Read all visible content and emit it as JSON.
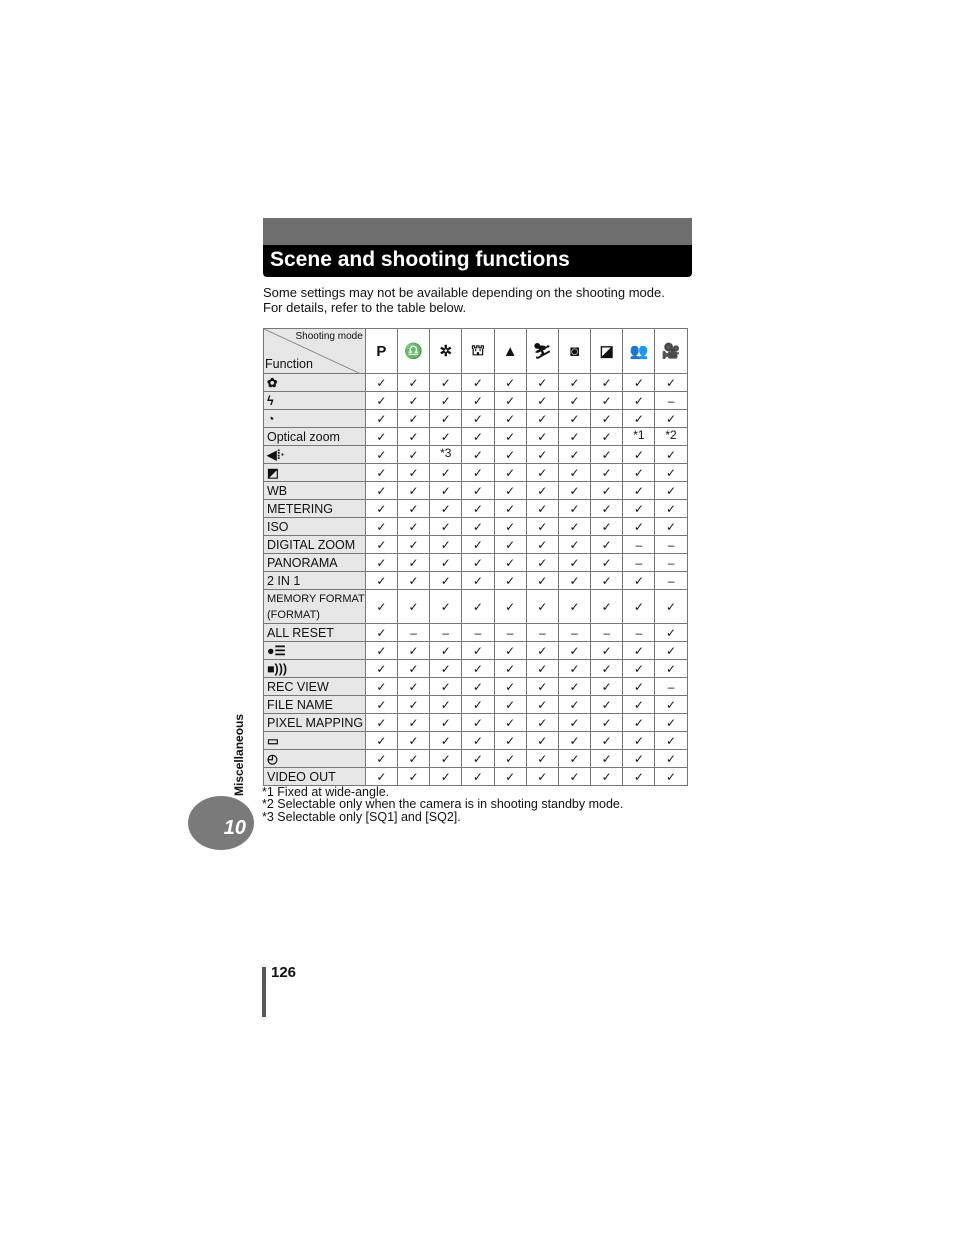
{
  "title": "Scene and shooting functions",
  "intro": [
    "Some settings may not be available depending on the shooting mode.",
    "For details, refer to the table below."
  ],
  "table": {
    "corner_top": "Shooting mode",
    "corner_bottom": "Function",
    "modes": [
      {
        "icon": "program-mode-icon",
        "glyph": "P"
      },
      {
        "icon": "portrait-icon",
        "glyph": "♎"
      },
      {
        "icon": "night-scene-icon",
        "glyph": "✲"
      },
      {
        "icon": "landscape-portrait-icon",
        "glyph": "⛫"
      },
      {
        "icon": "landscape-icon",
        "glyph": "▲"
      },
      {
        "icon": "sports-icon",
        "glyph": "⛷"
      },
      {
        "icon": "night-portrait-icon",
        "glyph": "◙"
      },
      {
        "icon": "self-portrait-icon",
        "glyph": "◪"
      },
      {
        "icon": "indoor-icon",
        "glyph": "👥"
      },
      {
        "icon": "movie-icon",
        "glyph": "🎥"
      }
    ],
    "rows": [
      {
        "label": "",
        "icon": "macro-icon",
        "glyph": "✿",
        "cells": [
          "✓",
          "✓",
          "✓",
          "✓",
          "✓",
          "✓",
          "✓",
          "✓",
          "✓",
          "✓"
        ]
      },
      {
        "label": "",
        "icon": "flash-icon",
        "glyph": "ϟ",
        "cells": [
          "✓",
          "✓",
          "✓",
          "✓",
          "✓",
          "✓",
          "✓",
          "✓",
          "✓",
          "–"
        ]
      },
      {
        "label": "",
        "icon": "self-timer-icon",
        "glyph": "◔",
        "cells": [
          "✓",
          "✓",
          "✓",
          "✓",
          "✓",
          "✓",
          "✓",
          "✓",
          "✓",
          "✓"
        ]
      },
      {
        "label": "Optical zoom",
        "cells": [
          "✓",
          "✓",
          "✓",
          "✓",
          "✓",
          "✓",
          "✓",
          "✓",
          "*1",
          "*2"
        ]
      },
      {
        "label": "",
        "icon": "image-quality-icon",
        "glyph": "◀⁞·",
        "cells": [
          "✓",
          "✓",
          "*3",
          "✓",
          "✓",
          "✓",
          "✓",
          "✓",
          "✓",
          "✓"
        ]
      },
      {
        "label": "",
        "icon": "exposure-compensation-icon",
        "glyph": "◩",
        "cells": [
          "✓",
          "✓",
          "✓",
          "✓",
          "✓",
          "✓",
          "✓",
          "✓",
          "✓",
          "✓"
        ]
      },
      {
        "label": "WB",
        "cells": [
          "✓",
          "✓",
          "✓",
          "✓",
          "✓",
          "✓",
          "✓",
          "✓",
          "✓",
          "✓"
        ]
      },
      {
        "label": "METERING",
        "cells": [
          "✓",
          "✓",
          "✓",
          "✓",
          "✓",
          "✓",
          "✓",
          "✓",
          "✓",
          "✓"
        ]
      },
      {
        "label": "ISO",
        "cells": [
          "✓",
          "✓",
          "✓",
          "✓",
          "✓",
          "✓",
          "✓",
          "✓",
          "✓",
          "✓"
        ]
      },
      {
        "label": "DIGITAL ZOOM",
        "cells": [
          "✓",
          "✓",
          "✓",
          "✓",
          "✓",
          "✓",
          "✓",
          "✓",
          "–",
          "–"
        ]
      },
      {
        "label": "PANORAMA",
        "cells": [
          "✓",
          "✓",
          "✓",
          "✓",
          "✓",
          "✓",
          "✓",
          "✓",
          "–",
          "–"
        ]
      },
      {
        "label": "2 IN 1",
        "cells": [
          "✓",
          "✓",
          "✓",
          "✓",
          "✓",
          "✓",
          "✓",
          "✓",
          "✓",
          "–"
        ]
      },
      {
        "label": "MEMORY FORMAT",
        "label2": "(FORMAT)",
        "cells": [
          "✓",
          "✓",
          "✓",
          "✓",
          "✓",
          "✓",
          "✓",
          "✓",
          "✓",
          "✓"
        ]
      },
      {
        "label": "ALL RESET",
        "cells": [
          "✓",
          "–",
          "–",
          "–",
          "–",
          "–",
          "–",
          "–",
          "–",
          "✓"
        ]
      },
      {
        "label": "",
        "icon": "language-icon",
        "glyph": "●☰",
        "cells": [
          "✓",
          "✓",
          "✓",
          "✓",
          "✓",
          "✓",
          "✓",
          "✓",
          "✓",
          "✓"
        ]
      },
      {
        "label": "",
        "icon": "beep-icon",
        "glyph": "■)))",
        "cells": [
          "✓",
          "✓",
          "✓",
          "✓",
          "✓",
          "✓",
          "✓",
          "✓",
          "✓",
          "✓"
        ]
      },
      {
        "label": "REC VIEW",
        "cells": [
          "✓",
          "✓",
          "✓",
          "✓",
          "✓",
          "✓",
          "✓",
          "✓",
          "✓",
          "–"
        ]
      },
      {
        "label": "FILE NAME",
        "cells": [
          "✓",
          "✓",
          "✓",
          "✓",
          "✓",
          "✓",
          "✓",
          "✓",
          "✓",
          "✓"
        ]
      },
      {
        "label": "PIXEL MAPPING",
        "cells": [
          "✓",
          "✓",
          "✓",
          "✓",
          "✓",
          "✓",
          "✓",
          "✓",
          "✓",
          "✓"
        ]
      },
      {
        "label": "",
        "icon": "monitor-brightness-icon",
        "glyph": "▭",
        "cells": [
          "✓",
          "✓",
          "✓",
          "✓",
          "✓",
          "✓",
          "✓",
          "✓",
          "✓",
          "✓"
        ]
      },
      {
        "label": "",
        "icon": "clock-icon",
        "glyph": "◴",
        "cells": [
          "✓",
          "✓",
          "✓",
          "✓",
          "✓",
          "✓",
          "✓",
          "✓",
          "✓",
          "✓"
        ]
      },
      {
        "label": "VIDEO OUT",
        "cells": [
          "✓",
          "✓",
          "✓",
          "✓",
          "✓",
          "✓",
          "✓",
          "✓",
          "✓",
          "✓"
        ]
      }
    ]
  },
  "notes": [
    "*1 Fixed at wide-angle.",
    "*2 Selectable only when the camera is in shooting standby mode.",
    "*3 Selectable only [SQ1] and [SQ2]."
  ],
  "side_label": "Miscellaneous",
  "chapter": "10",
  "page_number": "126"
}
